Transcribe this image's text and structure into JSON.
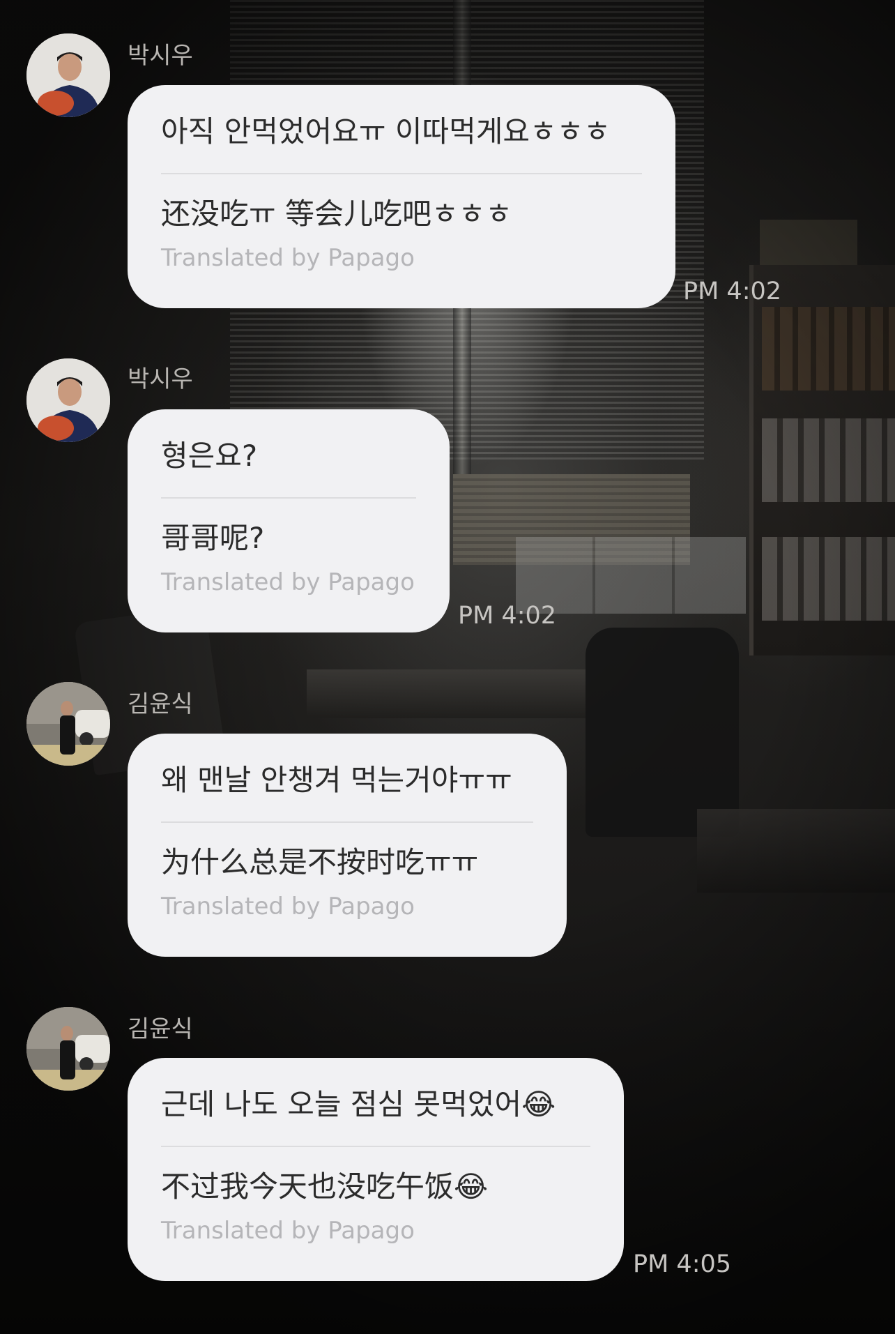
{
  "messages": [
    {
      "sender": "박시우",
      "original": "아직 안먹었어요ㅠ 이따먹게요ㅎㅎㅎ",
      "translation": "还没吃ㅠ 等会儿吃吧ㅎㅎㅎ",
      "credit": "Translated by Papago",
      "time": "PM 4:02"
    },
    {
      "sender": "박시우",
      "original": "형은요?",
      "translation": "哥哥呢?",
      "credit": "Translated by Papago",
      "time": "PM 4:02"
    },
    {
      "sender": "김윤식",
      "original": "왜 맨날 안챙겨 먹는거야ㅠㅠ",
      "translation": "为什么总是不按时吃ㅠㅠ",
      "credit": "Translated by Papago",
      "time": ""
    },
    {
      "sender": "김윤식",
      "original": "근데 나도 오늘 점심 못먹었어😂",
      "translation": "不过我今天也没吃午饭😂",
      "credit": "Translated by Papago",
      "time": "PM 4:05"
    }
  ]
}
